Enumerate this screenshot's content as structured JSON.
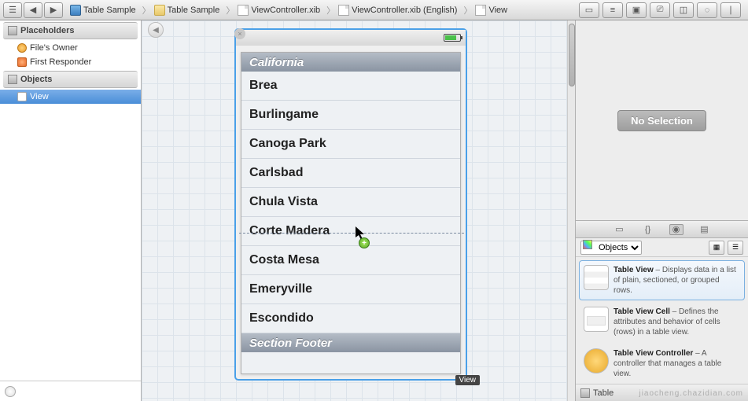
{
  "breadcrumb": [
    {
      "label": "Table Sample",
      "icon": "xcode"
    },
    {
      "label": "Table Sample",
      "icon": "folder"
    },
    {
      "label": "ViewController.xib",
      "icon": "doc"
    },
    {
      "label": "ViewController.xib (English)",
      "icon": "doc"
    },
    {
      "label": "View",
      "icon": "doc"
    }
  ],
  "outline": {
    "placeholders": {
      "header": "Placeholders",
      "items": [
        {
          "label": "File's Owner",
          "icon": "owner"
        },
        {
          "label": "First Responder",
          "icon": "responder"
        }
      ]
    },
    "objects": {
      "header": "Objects",
      "items": [
        {
          "label": "View",
          "icon": "view",
          "selected": true
        }
      ]
    }
  },
  "device": {
    "section_header": "California",
    "cells": [
      "Brea",
      "Burlingame",
      "Canoga Park",
      "Carlsbad",
      "Chula Vista",
      "Corte Madera",
      "Costa Mesa",
      "Emeryville",
      "Escondido"
    ],
    "section_footer": "Section Footer",
    "view_tag": "View"
  },
  "inspector": {
    "no_selection": "No Selection"
  },
  "library": {
    "filter": "Objects",
    "items": [
      {
        "name": "Table View",
        "desc": " – Displays data in a list of plain, sectioned, or grouped rows.",
        "thumb": "tv",
        "selected": true
      },
      {
        "name": "Table View Cell",
        "desc": " – Defines the attributes and behavior of cells (rows) in a table view.",
        "thumb": "tvc"
      },
      {
        "name": "Table View Controller",
        "desc": " – A controller that manages a table view.",
        "thumb": "tvctrl"
      }
    ],
    "footer": "Table"
  },
  "watermark": "jiaocheng.chazidian.com"
}
